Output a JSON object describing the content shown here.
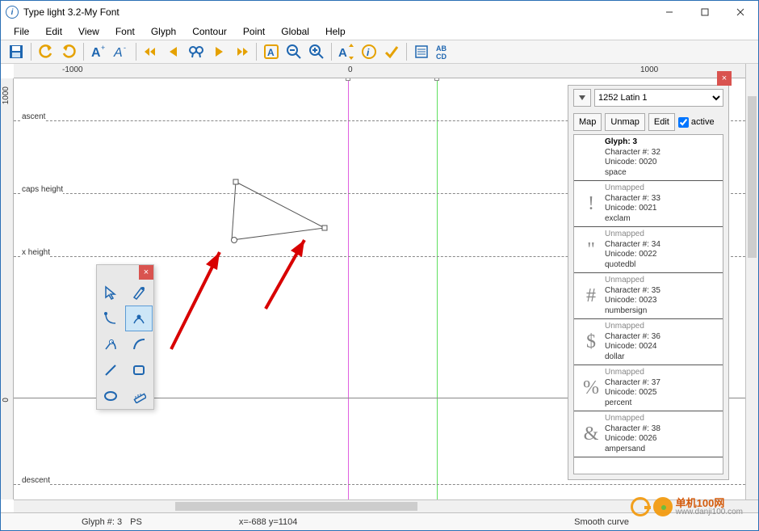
{
  "titlebar": {
    "app": "Type light 3.2",
    "sep": "  -  ",
    "doc": "My Font"
  },
  "menubar": [
    "File",
    "Edit",
    "View",
    "Font",
    "Glyph",
    "Contour",
    "Point",
    "Global",
    "Help"
  ],
  "ruler": {
    "h": {
      "-1000": "-1000",
      "0": "0",
      "1000": "1000"
    },
    "v": {
      "1000": "1000",
      "0": "0"
    }
  },
  "metrics": {
    "ascent": "ascent",
    "caps": "caps height",
    "xheight": "x height",
    "descent": "descent"
  },
  "sidepanel": {
    "encoding": "1252 Latin 1",
    "btn_map": "Map",
    "btn_unmap": "Unmap",
    "btn_edit": "Edit",
    "chk_active": "active",
    "glyphs": [
      {
        "char": "",
        "active": true,
        "title": "Glyph: 3",
        "charno": "Character #: 32",
        "unicode": "Unicode: 0020",
        "name": "space"
      },
      {
        "char": "!",
        "unmapped": "Unmapped",
        "charno": "Character #: 33",
        "unicode": "Unicode: 0021",
        "name": "exclam"
      },
      {
        "char": "\"",
        "unmapped": "Unmapped",
        "charno": "Character #: 34",
        "unicode": "Unicode: 0022",
        "name": "quotedbl"
      },
      {
        "char": "#",
        "unmapped": "Unmapped",
        "charno": "Character #: 35",
        "unicode": "Unicode: 0023",
        "name": "numbersign"
      },
      {
        "char": "$",
        "unmapped": "Unmapped",
        "charno": "Character #: 36",
        "unicode": "Unicode: 0024",
        "name": "dollar"
      },
      {
        "char": "%",
        "unmapped": "Unmapped",
        "charno": "Character #: 37",
        "unicode": "Unicode: 0025",
        "name": "percent"
      },
      {
        "char": "&",
        "unmapped": "Unmapped",
        "charno": "Character #: 38",
        "unicode": "Unicode: 0026",
        "name": "ampersand"
      }
    ]
  },
  "status": {
    "glyph": "Glyph #: 3",
    "ps": "PS",
    "coords": "x=-688  y=1104",
    "mode": "Smooth curve"
  },
  "watermark": {
    "brand": "单机100网",
    "url": "www.danji100.com"
  }
}
